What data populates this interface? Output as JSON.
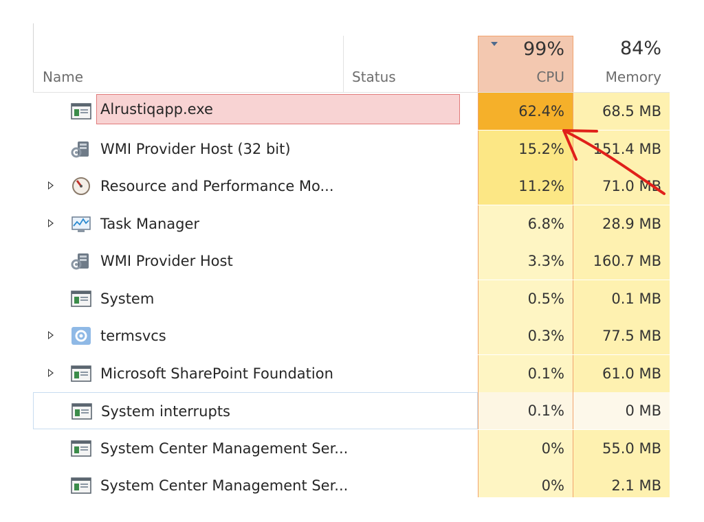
{
  "header": {
    "name_label": "Name",
    "status_label": "Status",
    "cpu_percent": "99%",
    "cpu_label": "CPU",
    "memory_percent": "84%",
    "memory_label": "Memory"
  },
  "colors": {
    "cpu_header_bg": "#f3c8b0",
    "cpu_column_border": "#f1a36d",
    "highlight_box_fill": "#f8d3d3",
    "highlight_box_border": "#e07a7a",
    "annotation_arrow": "#e0201a"
  },
  "processes": [
    {
      "name": "Alrustiqapp.exe",
      "icon": "window-app-icon",
      "expandable": false,
      "cpu": "62.4%",
      "memory": "68.5 MB",
      "highlighted": true
    },
    {
      "name": "WMI Provider Host (32 bit)",
      "icon": "wmi-provider-icon",
      "expandable": false,
      "cpu": "15.2%",
      "memory": "151.4 MB"
    },
    {
      "name": "Resource and Performance Mo...",
      "icon": "gauge-icon",
      "expandable": true,
      "cpu": "11.2%",
      "memory": "71.0 MB"
    },
    {
      "name": "Task Manager",
      "icon": "task-manager-icon",
      "expandable": true,
      "cpu": "6.8%",
      "memory": "28.9 MB"
    },
    {
      "name": "WMI Provider Host",
      "icon": "wmi-provider-icon",
      "expandable": false,
      "cpu": "3.3%",
      "memory": "160.7 MB"
    },
    {
      "name": "System",
      "icon": "window-app-icon",
      "expandable": false,
      "cpu": "0.5%",
      "memory": "0.1 MB"
    },
    {
      "name": "termsvcs",
      "icon": "gear-icon",
      "expandable": true,
      "cpu": "0.3%",
      "memory": "77.5 MB"
    },
    {
      "name": "Microsoft SharePoint Foundation",
      "icon": "window-app-icon",
      "expandable": true,
      "cpu": "0.1%",
      "memory": "61.0 MB"
    },
    {
      "name": "System interrupts",
      "icon": "window-app-icon",
      "expandable": false,
      "cpu": "0.1%",
      "memory": "0 MB",
      "selected": true
    },
    {
      "name": "System Center Management Ser...",
      "icon": "window-app-icon",
      "expandable": false,
      "cpu": "0%",
      "memory": "55.0 MB"
    },
    {
      "name": "System Center Management Ser...",
      "icon": "window-app-icon",
      "expandable": false,
      "cpu": "0%",
      "memory": "2.1 MB"
    }
  ]
}
